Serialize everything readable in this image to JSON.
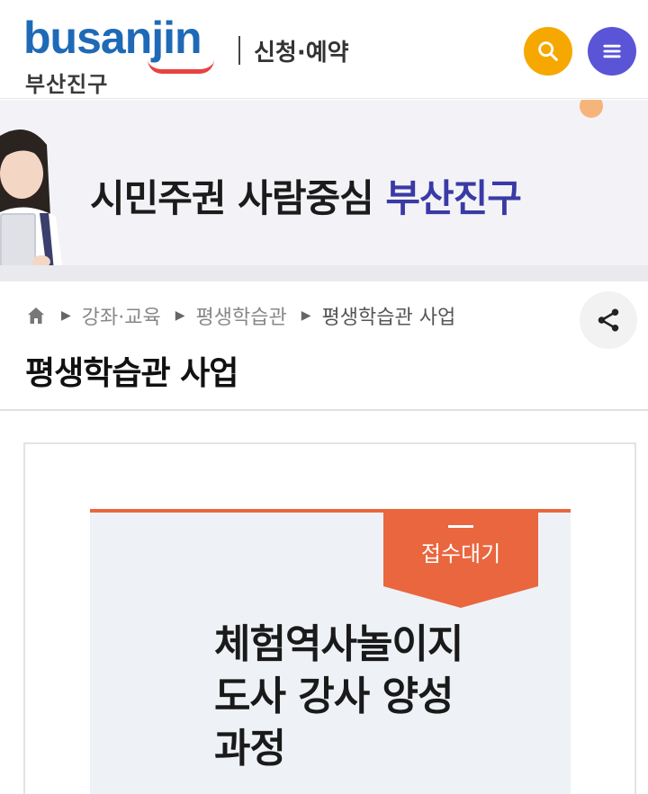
{
  "header": {
    "logo_text": "busanjin",
    "logo_subtext": "부산진구",
    "section_label": "신청·예약",
    "search_icon": "search-icon",
    "menu_icon": "hamburger-menu-icon",
    "colors": {
      "logo": "#1f6ab7",
      "search_button": "#f6a800",
      "menu_button": "#5a55d6"
    }
  },
  "banner": {
    "slogan_main": "시민주권 사람중심 ",
    "slogan_accent": "부산진구",
    "accent_color": "#3a3aa6"
  },
  "breadcrumb": {
    "home_icon": "home-icon",
    "items": [
      "강좌·교육",
      "평생학습관",
      "평생학습관 사업"
    ]
  },
  "page": {
    "title": "평생학습관 사업",
    "share_icon": "share-icon"
  },
  "program": {
    "status": "접수대기",
    "status_color": "#e9663f",
    "title_lines": [
      "체험역사놀이지",
      "도사 강사 양성",
      "과정"
    ]
  }
}
